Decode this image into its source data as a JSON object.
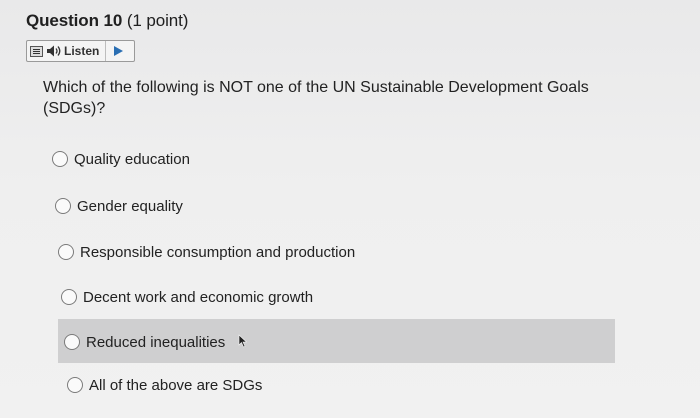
{
  "question": {
    "number_label": "Question 10",
    "points_label": "(1 point)",
    "text": "Which of the following is NOT one of the UN Sustainable Development Goals (SDGs)?"
  },
  "listen": {
    "label": "Listen",
    "icons": [
      "menu-icon",
      "speaker-icon",
      "play-icon"
    ]
  },
  "options": [
    {
      "label": "Quality education",
      "selected": false
    },
    {
      "label": "Gender equality",
      "selected": false
    },
    {
      "label": "Responsible consumption and production",
      "selected": false
    },
    {
      "label": "Decent work and economic growth",
      "selected": false
    },
    {
      "label": "Reduced inequalities",
      "selected": false,
      "hovered": true
    },
    {
      "label": "All of the above are SDGs",
      "selected": false
    }
  ],
  "colors": {
    "accent": "#2b6fb3",
    "hover_background": "#cfcfd0"
  }
}
